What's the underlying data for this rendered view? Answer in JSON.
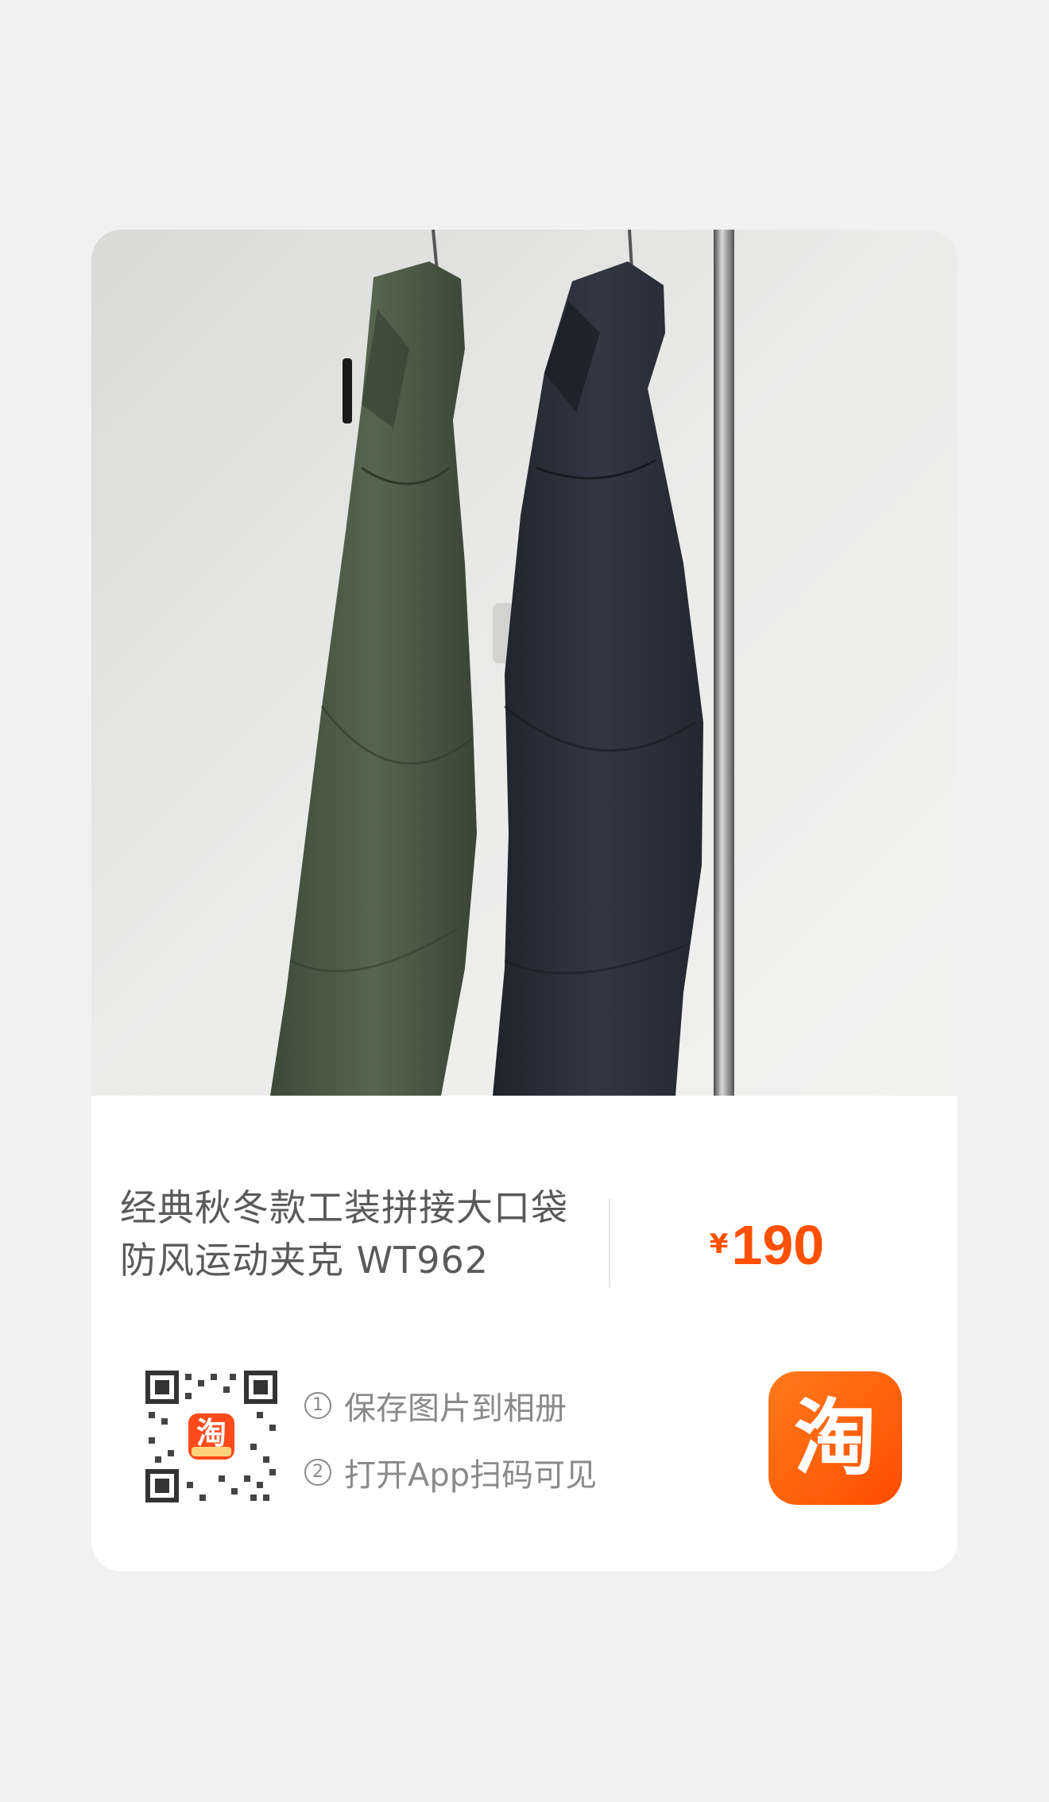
{
  "product": {
    "title_line1": "经典秋冬款工装拼接大口袋",
    "title_line2": "防风运动夹克 WT962",
    "price_symbol": "¥",
    "price_value": "190"
  },
  "share": {
    "step1_num": "1",
    "step1_text": "保存图片到相册",
    "step2_num": "2",
    "step2_text": "打开App扫码可见",
    "app_logo_char": "淘",
    "qr_center_char": "淘"
  },
  "colors": {
    "accent": "#ff5000",
    "jacket_left": "#4b5a46",
    "jacket_right": "#2a2e38"
  },
  "icons": {
    "qr": "qr-code-icon",
    "logo": "taobao-logo-icon"
  }
}
